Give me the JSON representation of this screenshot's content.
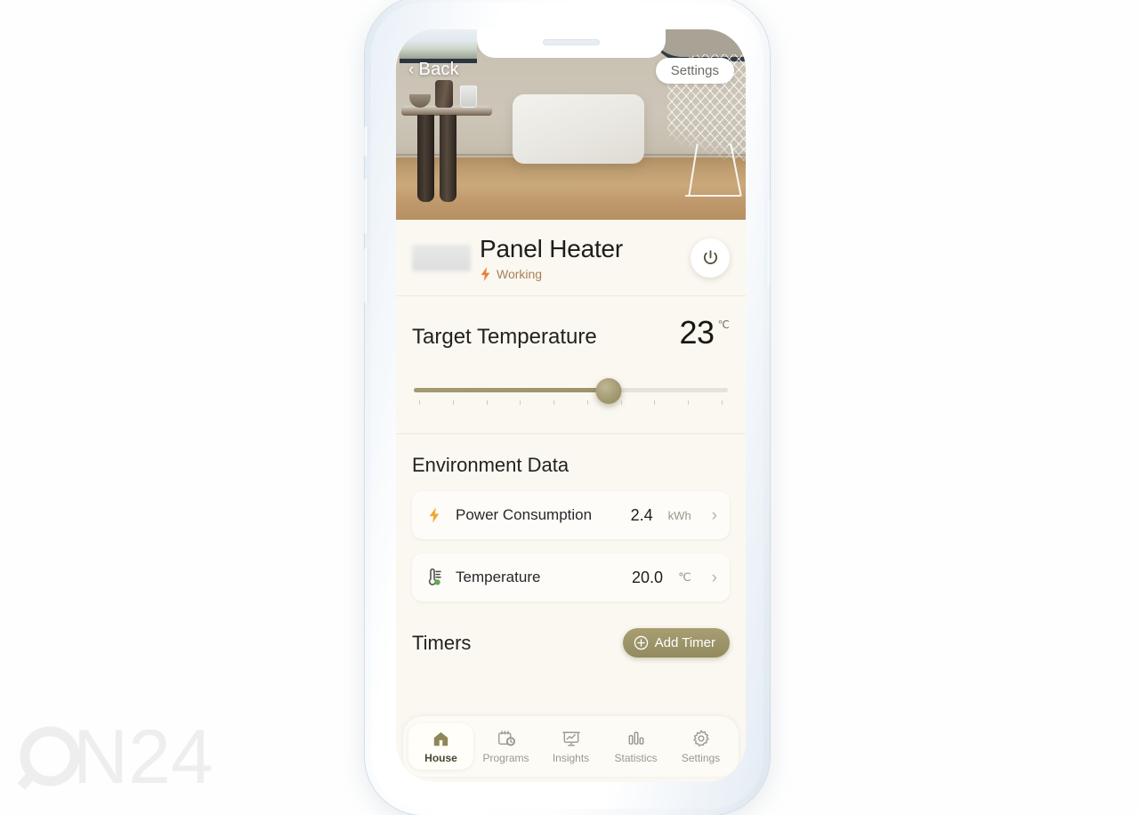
{
  "watermark": {
    "text": "ON24"
  },
  "hero": {
    "back_label": "Back",
    "back_chevron": "‹",
    "settings_label": "Settings"
  },
  "device": {
    "name": "Panel Heater",
    "status": "Working",
    "status_icon": "lightning-bolt-icon",
    "power_icon": "power-icon"
  },
  "target": {
    "label": "Target Temperature",
    "value": "23",
    "unit": "℃",
    "slider_percent": 62,
    "tick_count": 10
  },
  "environment": {
    "title": "Environment Data",
    "rows": [
      {
        "icon": "lightning-bolt-icon",
        "label": "Power Consumption",
        "value": "2.4",
        "unit": "kWh",
        "chevron": "›"
      },
      {
        "icon": "thermometer-icon",
        "label": "Temperature",
        "value": "20.0",
        "unit": "℃",
        "chevron": "›"
      }
    ]
  },
  "timers": {
    "title": "Timers",
    "add_label": "Add Timer",
    "add_icon": "plus-circle-icon"
  },
  "tabbar": {
    "items": [
      {
        "label": "House",
        "icon": "home-icon",
        "active": true
      },
      {
        "label": "Programs",
        "icon": "calendar-clock-icon",
        "active": false
      },
      {
        "label": "Insights",
        "icon": "chart-board-icon",
        "active": false
      },
      {
        "label": "Statistics",
        "icon": "bar-chart-icon",
        "active": false
      },
      {
        "label": "Settings",
        "icon": "gear-icon",
        "active": false
      }
    ]
  },
  "colors": {
    "accent_olive": "#9d9469",
    "status_orange": "#e8813a",
    "status_text": "#a8805a",
    "app_bg": "#faf8f1",
    "device_frame": "#e8eef5"
  }
}
